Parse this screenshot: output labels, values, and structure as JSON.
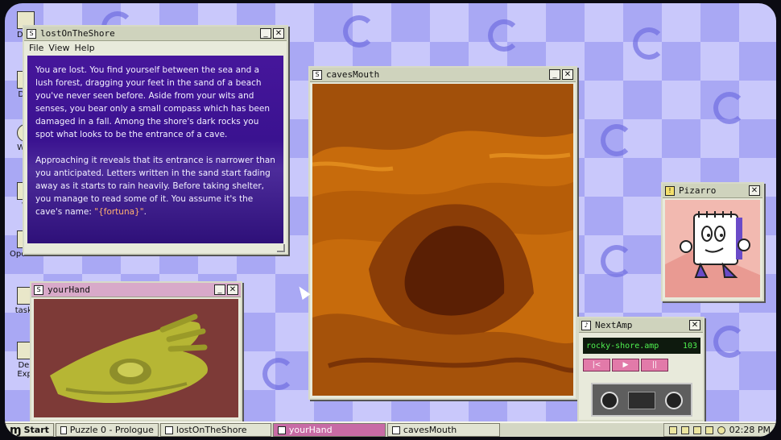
{
  "desktop_icons": [
    {
      "label": "Dow",
      "icon": "folder-icon"
    },
    {
      "label": "Doc",
      "icon": "document-icon"
    },
    {
      "label": "Web",
      "icon": "globe-icon"
    },
    {
      "label": "W",
      "icon": "app-icon"
    },
    {
      "label": "OpenMe",
      "icon": "disk-icon"
    },
    {
      "label": "taskli",
      "icon": "notepad-icon"
    },
    {
      "label": "Des",
      "icon": "folder-icon"
    },
    {
      "label": "Expl",
      "icon": "explorer-icon"
    }
  ],
  "story_window": {
    "title": "lostOnTheShore",
    "menu": [
      "File",
      "View",
      "Help"
    ],
    "paragraph1": "You are lost. You find yourself between the sea and a lush forest, dragging your feet in the sand of a beach you've never seen before. Aside from your wits and senses, you bear only a small compass which has been damaged in a fall. Among the shore's dark rocks you spot what looks to be the entrance of a cave.",
    "paragraph2_text": "Approaching it reveals that its entrance is narrower than you anticipated. Letters written in the sand start fading away as it starts to rain heavily. Before taking shelter, you manage to read some of it. You assume it's the cave's name: ",
    "paragraph2_highlight": "\"{fortuna}\"",
    "paragraph2_end": "."
  },
  "hand_window": {
    "title": "yourHand"
  },
  "cave_window": {
    "title": "cavesMouth"
  },
  "pizarro_window": {
    "title": "Pizarro"
  },
  "amp_window": {
    "title": "NextAmp",
    "track": "rocky-shore.amp",
    "track_number": "103",
    "prev_label": "|<",
    "play_label": "▶",
    "pause_label": "||"
  },
  "taskbar": {
    "start_label": "Start",
    "tasks": [
      {
        "label": "Puzzle 0 - Prologue",
        "active": false
      },
      {
        "label": "lostOnTheShore",
        "active": false
      },
      {
        "label": "yourHand",
        "active": true
      },
      {
        "label": "cavesMouth",
        "active": false
      }
    ],
    "clock": "02:28 PM"
  },
  "colors": {
    "accent": "#c86ba5",
    "desktop": "#a9a8f4",
    "story_bg": "#46169b",
    "cave_bg": "#c4680a"
  }
}
